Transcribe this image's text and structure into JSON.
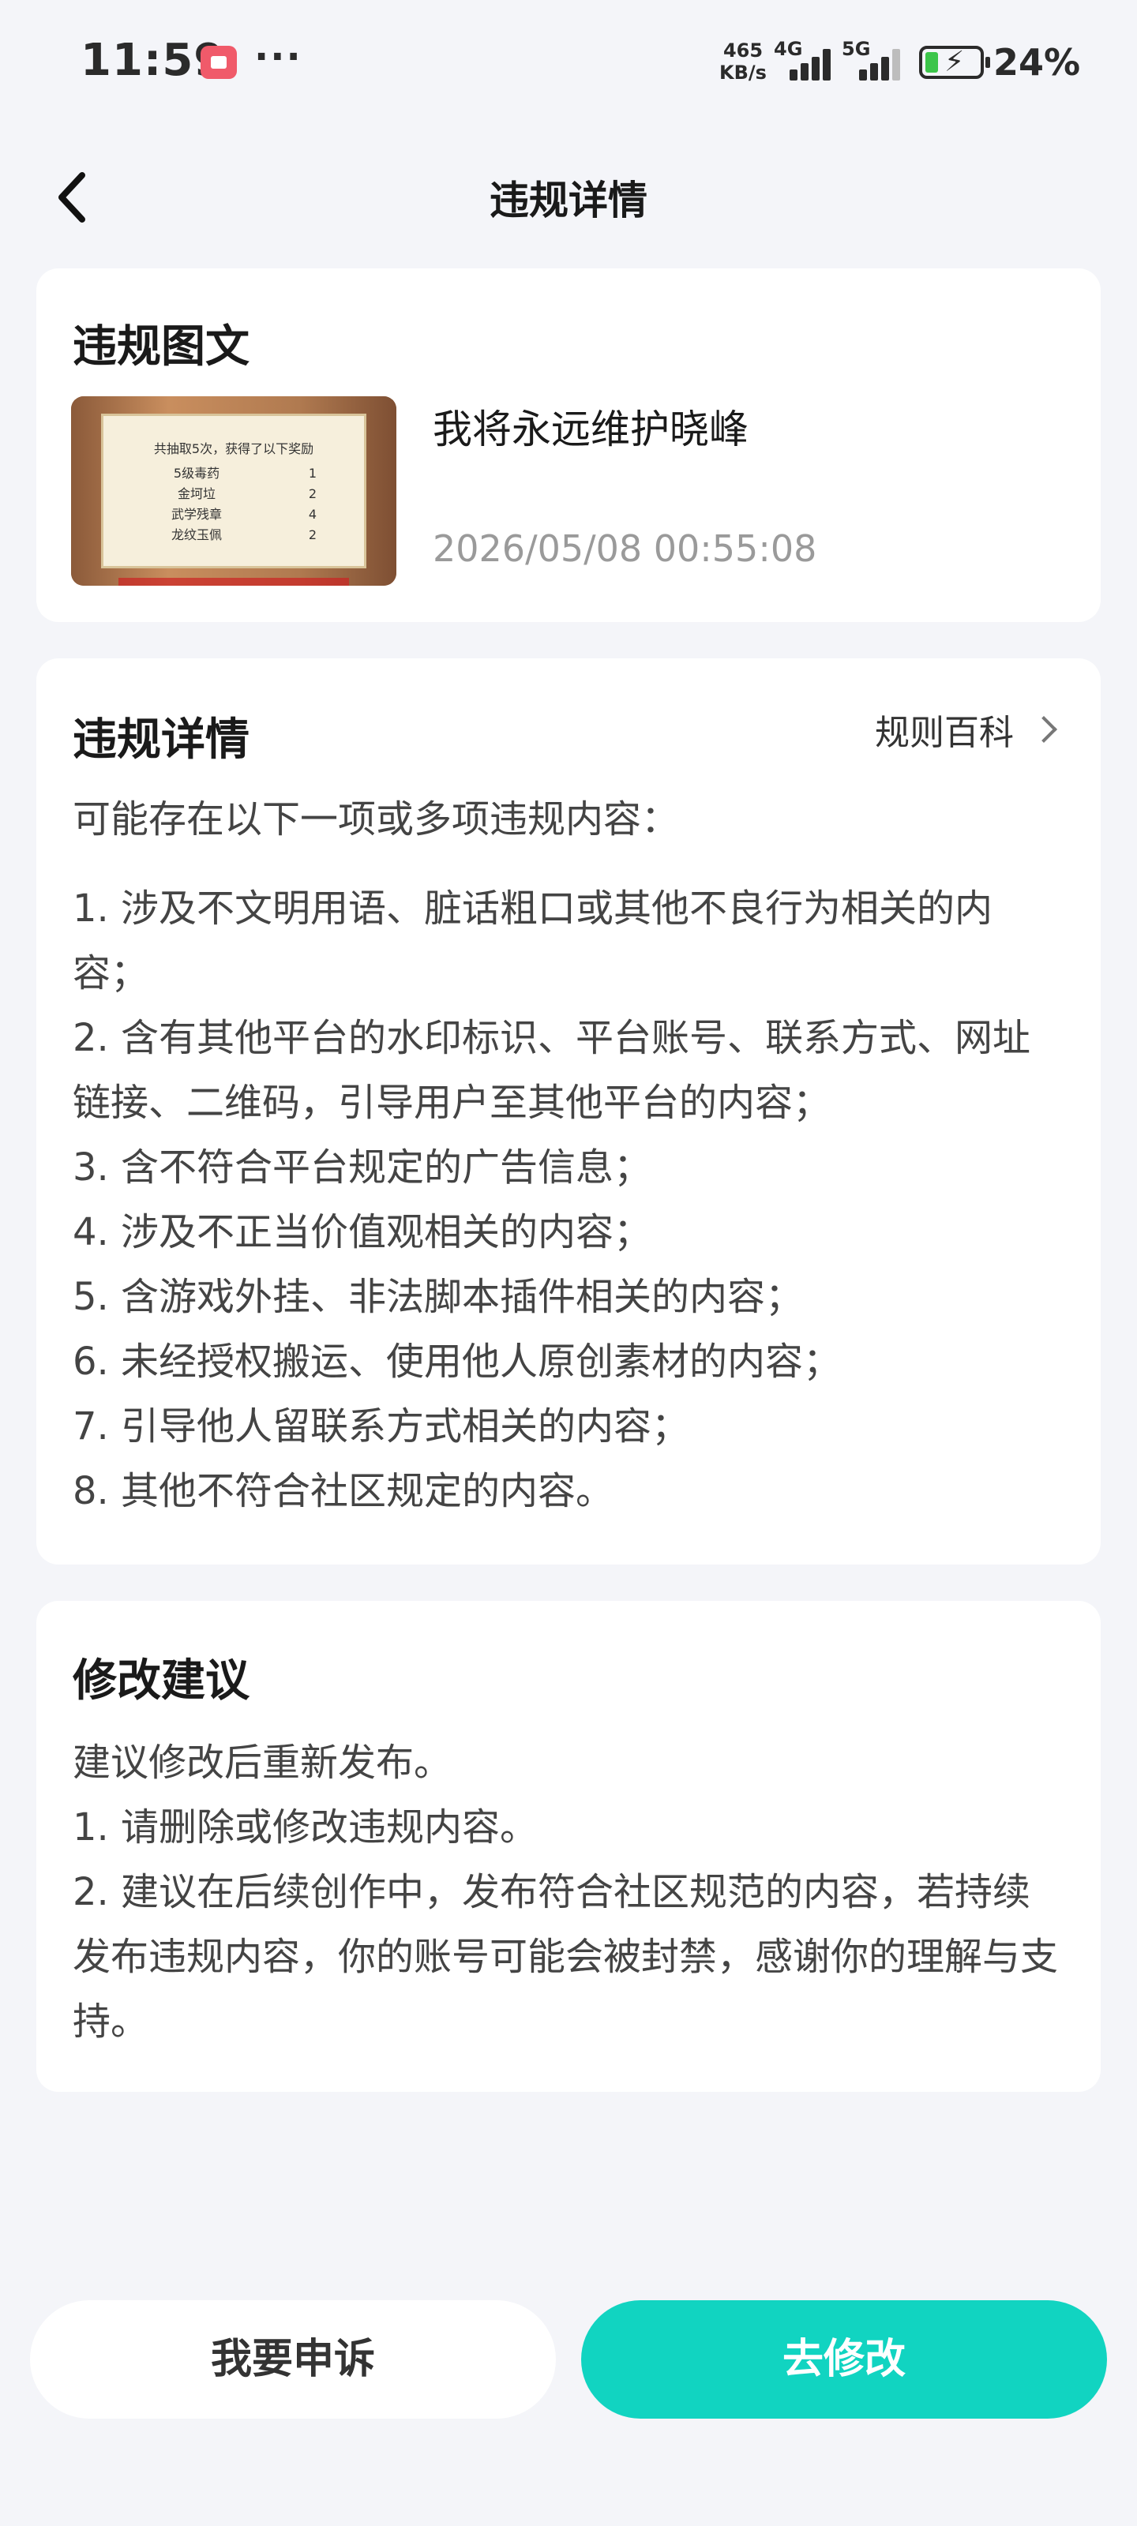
{
  "status_bar": {
    "time": "11:59",
    "more": "···",
    "speed_value": "465",
    "speed_unit": "KB/s",
    "net1": "4G",
    "net2": "5G",
    "battery": "24%"
  },
  "nav": {
    "title": "违规详情",
    "back_icon": "chevron-left-icon"
  },
  "violation_post": {
    "section_title": "违规图文",
    "post_title": "我将永远维护晓峰",
    "timestamp": "2026/05/08 00:55:08",
    "thumbnail": {
      "header": "共抽取5次，获得了以下奖励",
      "rows": [
        {
          "item": "5级毒药",
          "count": "1"
        },
        {
          "item": "金坷垃",
          "count": "2"
        },
        {
          "item": "武学残章",
          "count": "4"
        },
        {
          "item": "龙纹玉佩",
          "count": "2"
        }
      ]
    }
  },
  "violation_details": {
    "section_title": "违规详情",
    "rules_link": "规则百科",
    "intro": "可能存在以下一项或多项违规内容：",
    "items": [
      "1. 涉及不文明用语、脏话粗口或其他不良行为相关的内容；",
      "2. 含有其他平台的水印标识、平台账号、联系方式、网址链接、二维码，引导用户至其他平台的内容；",
      "3. 含不符合平台规定的广告信息；",
      "4. 涉及不正当价值观相关的内容；",
      "5. 含游戏外挂、非法脚本插件相关的内容；",
      "6. 未经授权搬运、使用他人原创素材的内容；",
      "7. 引导他人留联系方式相关的内容；",
      "8. 其他不符合社区规定的内容。"
    ]
  },
  "suggestions": {
    "section_title": "修改建议",
    "lines": [
      "建议修改后重新发布。",
      "1. 请删除或修改违规内容。",
      "2. 建议在后续创作中，发布符合社区规范的内容，若持续发布违规内容，你的账号可能会被封禁，感谢你的理解与支持。"
    ]
  },
  "actions": {
    "appeal": "我要申诉",
    "edit": "去修改"
  },
  "colors": {
    "accent": "#11D4C1",
    "background": "#F4F5F9"
  }
}
